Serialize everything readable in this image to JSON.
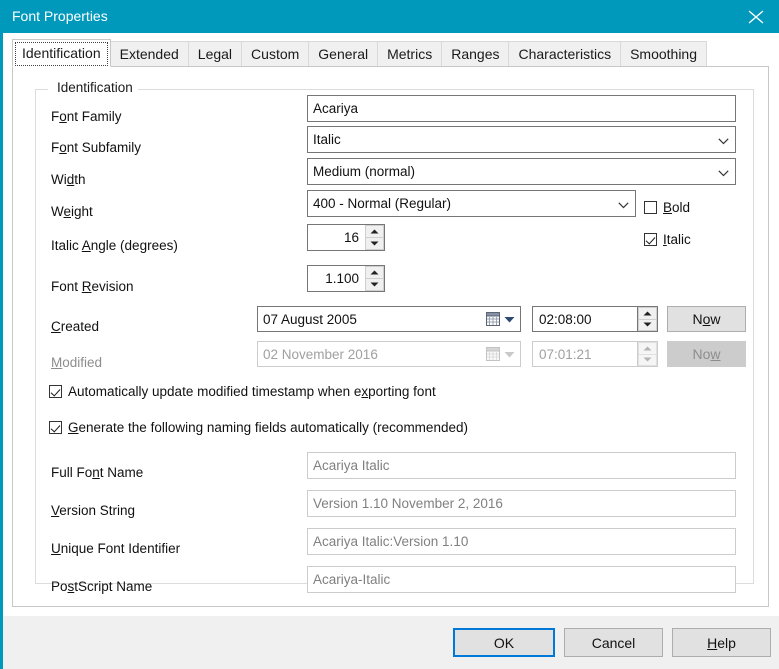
{
  "window": {
    "title": "Font Properties",
    "close_icon": "close-icon",
    "titlebar_color": "#0099bc"
  },
  "tabs": [
    {
      "label": "Identification",
      "selected": true
    },
    {
      "label": "Extended",
      "selected": false
    },
    {
      "label": "Legal",
      "selected": false
    },
    {
      "label": "Custom",
      "selected": false
    },
    {
      "label": "General",
      "selected": false
    },
    {
      "label": "Metrics",
      "selected": false
    },
    {
      "label": "Ranges",
      "selected": false
    },
    {
      "label": "Characteristics",
      "selected": false
    },
    {
      "label": "Smoothing",
      "selected": false
    }
  ],
  "group": {
    "legend": "Identification"
  },
  "fields": {
    "font_family": {
      "label_pre": "F",
      "label_acc": "o",
      "label_post": "nt Family",
      "value": "Acariya"
    },
    "font_subfamily": {
      "label_pre": "F",
      "label_acc": "o",
      "label_post": "nt Subfamily",
      "value": "Italic"
    },
    "width": {
      "label_pre": "Wi",
      "label_acc": "d",
      "label_post": "th",
      "value": "Medium (normal)"
    },
    "weight": {
      "label_pre": "W",
      "label_acc": "e",
      "label_post": "ight",
      "value": "400 - Normal (Regular)"
    },
    "italic_angle": {
      "label_pre": "Italic ",
      "label_acc": "A",
      "label_post": "ngle (degrees)",
      "value": "16"
    },
    "font_revision": {
      "label_pre": "Font ",
      "label_acc": "R",
      "label_post": "evision",
      "value": "1.100"
    },
    "created": {
      "label_pre": "",
      "label_acc": "C",
      "label_post": "reated",
      "date": "07    August    2005",
      "time": "02:08:00",
      "now_pre": "N",
      "now_acc": "o",
      "now_post": "w",
      "enabled": true
    },
    "modified": {
      "label_pre": "",
      "label_acc": "M",
      "label_post": "odified",
      "date": "02 November 2016",
      "time": "07:01:21",
      "now_pre": "No",
      "now_acc": "w",
      "now_post": "",
      "enabled": false
    },
    "full_font_name": {
      "label_pre": "Full Fo",
      "label_acc": "n",
      "label_post": "t Name",
      "value": "Acariya Italic"
    },
    "version_string": {
      "label_pre": "",
      "label_acc": "V",
      "label_post": "ersion String",
      "value": "Version 1.10 November 2, 2016"
    },
    "unique_font_identifier": {
      "label_pre": "",
      "label_acc": "U",
      "label_post": "nique Font Identifier",
      "value": "Acariya Italic:Version 1.10"
    },
    "postscript_name": {
      "label_pre": "Po",
      "label_acc": "s",
      "label_post": "tScript Name",
      "value": "Acariya-Italic"
    }
  },
  "checkboxes": {
    "bold": {
      "label_pre": "",
      "label_acc": "B",
      "label_post": "old",
      "checked": false
    },
    "italic": {
      "label_pre": "",
      "label_acc": "I",
      "label_post": "talic",
      "checked": true
    },
    "auto_update_modified": {
      "label_pre": "Automatically update modified timestamp when e",
      "label_acc": "x",
      "label_post": "porting font",
      "checked": true
    },
    "generate_naming": {
      "label_pre": "",
      "label_acc": "G",
      "label_post": "enerate the following naming fields automatically (recommended)",
      "checked": true
    }
  },
  "buttons": {
    "ok": {
      "label": "OK",
      "default": true
    },
    "cancel": {
      "label": "Cancel",
      "default": false
    },
    "help": {
      "label_pre": "",
      "label_acc": "H",
      "label_post": "elp",
      "default": false
    }
  },
  "colors": {
    "accent": "#0099bc",
    "focus_blue": "#0078d7",
    "field_border": "#767676",
    "disabled_text": "#a0a0a0"
  }
}
